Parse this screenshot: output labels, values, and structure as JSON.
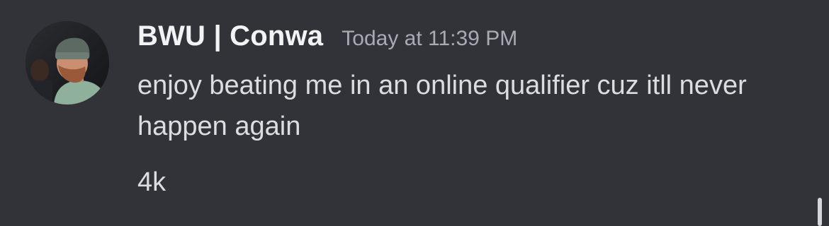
{
  "message": {
    "username": "BWU | Conwa",
    "timestamp": "Today at 11:39 PM",
    "content": "enjoy beating me in an online qualifier cuz itll never happen again",
    "extra": "4k"
  },
  "avatar": {
    "icon": "user-avatar-photo"
  },
  "colors": {
    "background": "#313338",
    "username": "#f2f3f5",
    "timestamp": "#a8abb3",
    "text": "#dbdee1"
  }
}
